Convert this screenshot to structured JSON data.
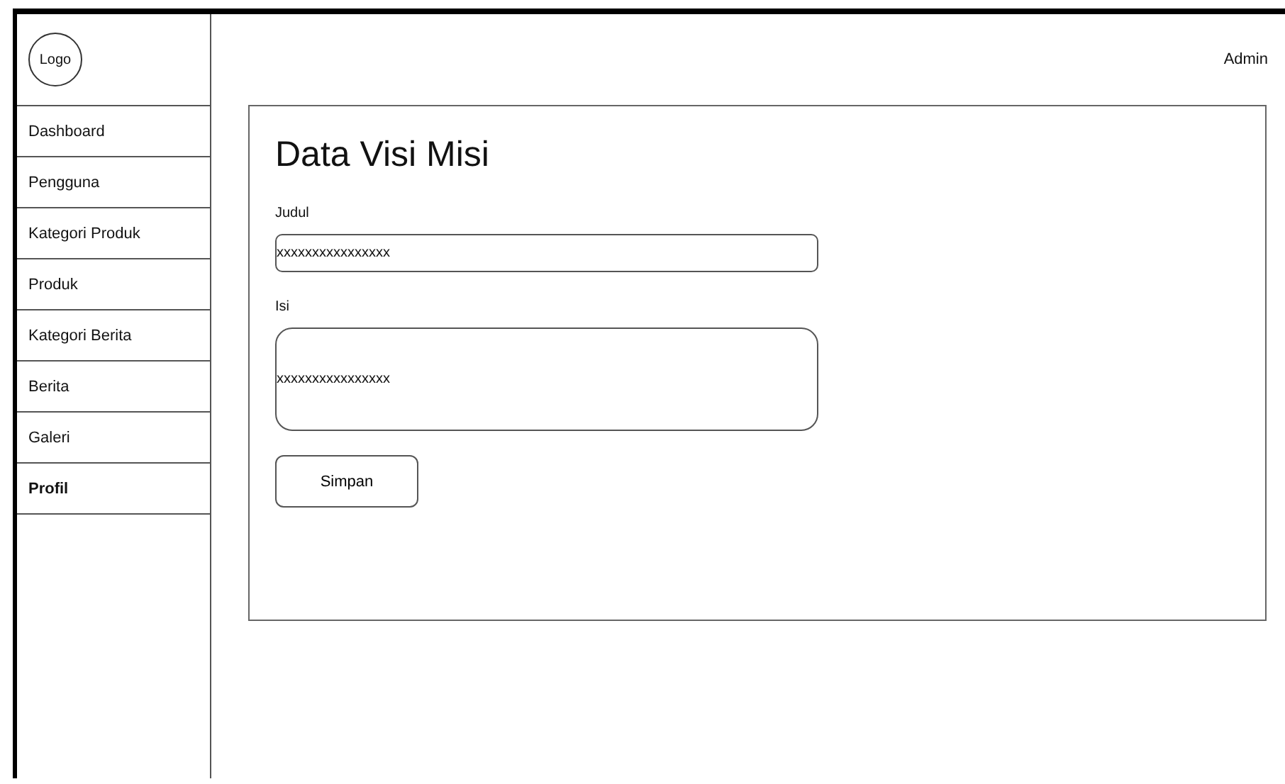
{
  "logo": "Logo",
  "sidebar": {
    "items": [
      {
        "label": "Dashboard",
        "selected": false
      },
      {
        "label": "Pengguna",
        "selected": false
      },
      {
        "label": "Kategori Produk",
        "selected": false
      },
      {
        "label": "Produk",
        "selected": false
      },
      {
        "label": "Kategori Berita",
        "selected": false
      },
      {
        "label": "Berita",
        "selected": false
      },
      {
        "label": "Galeri",
        "selected": false
      },
      {
        "label": "Profil",
        "selected": true
      }
    ]
  },
  "header": {
    "user": "Admin"
  },
  "form": {
    "title": "Data Visi Misi",
    "fields": [
      {
        "kind": "input",
        "label": "Judul",
        "value": "xxxxxxxxxxxxxxxx"
      },
      {
        "kind": "textarea",
        "label": "Isi",
        "value": "xxxxxxxxxxxxxxxx"
      }
    ],
    "button": "Simpan"
  }
}
